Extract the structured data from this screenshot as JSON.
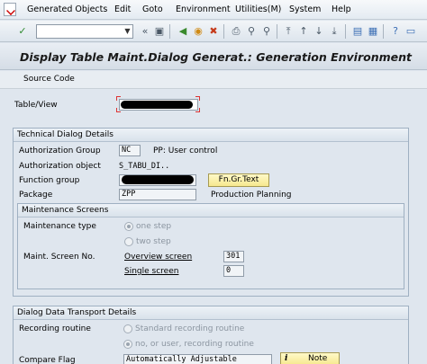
{
  "menu": {
    "items": [
      "Generated Objects",
      "Edit",
      "Goto",
      "Environment",
      "Utilities(M)",
      "System",
      "Help"
    ]
  },
  "toolbar": {
    "command_value": "",
    "icons": [
      "enter-icon",
      "back-icon",
      "save-icon",
      "exit-icon",
      "cancel-icon",
      "print-icon",
      "find-icon",
      "find-next-icon",
      "first-page-icon",
      "previous-page-icon",
      "next-page-icon",
      "last-page-icon",
      "new-session-icon",
      "shortcut-icon",
      "help-icon"
    ]
  },
  "title": "Display Table Maint.Dialog Generat.: Generation Environment",
  "app_toolbar": {
    "source_code": "Source Code"
  },
  "table_view": {
    "label": "Table/View",
    "value": ""
  },
  "technical": {
    "title": "Technical Dialog Details",
    "auth_group_label": "Authorization Group",
    "auth_group_value": "NC",
    "auth_group_desc": "PP: User control",
    "auth_object_label": "Authorization object",
    "auth_object_value": "S_TABU_DI..",
    "function_group_label": "Function group",
    "function_group_value": "",
    "fn_gr_text_button": "Fn.Gr.Text",
    "package_label": "Package",
    "package_value": "ZPP",
    "package_desc": "Production Planning"
  },
  "maintenance": {
    "title": "Maintenance Screens",
    "type_label": "Maintenance type",
    "one_step": "one step",
    "two_step": "two step",
    "screen_no_label": "Maint. Screen No.",
    "overview_label": "Overview screen",
    "overview_value": "301",
    "single_label": "Single screen",
    "single_value": "0"
  },
  "transport": {
    "title": "Dialog Data Transport Details",
    "recording_label": "Recording routine",
    "standard": "Standard recording routine",
    "no_user": "no, or user, recording routine",
    "compare_label": "Compare Flag",
    "compare_value": "Automatically Adjustable",
    "note_button": "Note"
  }
}
